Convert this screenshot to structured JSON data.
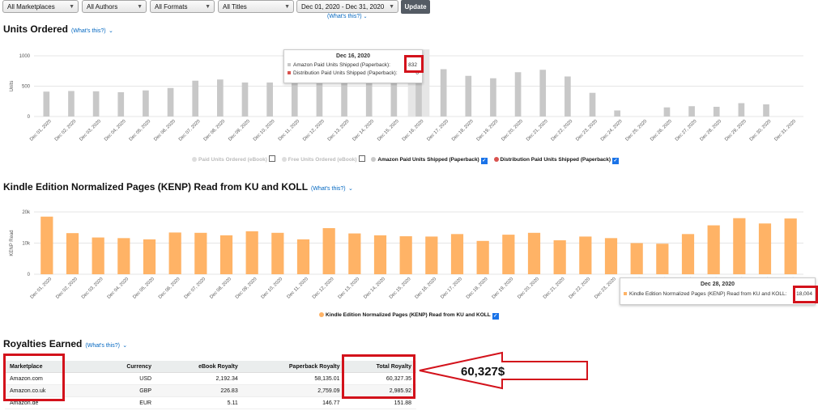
{
  "filters": {
    "marketplaces": "All Marketplaces",
    "authors": "All Authors",
    "formats": "All Formats",
    "titles": "All Titles",
    "date_range": "Dec 01, 2020 - Dec 31, 2020",
    "update_label": "Update",
    "whats_this": "(What's this?)"
  },
  "units": {
    "title": "Units Ordered",
    "whats_this": "(What's this?)",
    "ylabel": "Units",
    "yticks": [
      "1000",
      "500",
      "0"
    ],
    "legend": {
      "paid_ebook": "Paid Units Ordered (eBook)",
      "free_ebook": "Free Units Ordered (eBook)",
      "amazon_paid": "Amazon Paid Units Shipped (Paperback)",
      "distribution_paid": "Distribution Paid Units Shipped (Paperback)"
    },
    "tooltip": {
      "date": "Dec 16, 2020",
      "row1_label": "Amazon Paid Units Shipped (Paperback):",
      "row1_value": "832",
      "row2_label": "Distribution Paid Units Shipped (Paperback):",
      "row2_value": "0"
    }
  },
  "kenp": {
    "title": "Kindle Edition Normalized Pages (KENP) Read from KU and KOLL",
    "whats_this": "(What's this?)",
    "ylabel": "KENP Read",
    "yticks": [
      "20k",
      "10k",
      "0"
    ],
    "legend": "Kindle Edition Normalized Pages (KENP) Read from KU and KOLL",
    "tooltip": {
      "date": "Dec 28, 2020",
      "label": "Kindle Edition Normalized Pages (KENP) Read from KU and KOLL:",
      "value": "18,004"
    }
  },
  "royalties": {
    "title": "Royalties Earned",
    "whats_this": "(What's this?)",
    "columns": [
      "Marketplace",
      "Currency",
      "eBook Royalty",
      "Paperback Royalty",
      "Total Royalty"
    ],
    "rows": [
      [
        "Amazon.com",
        "USD",
        "2,192.34",
        "58,135.01",
        "60,327.35"
      ],
      [
        "Amazon.co.uk",
        "GBP",
        "226.83",
        "2,759.09",
        "2,985.92"
      ],
      [
        "Amazon.de",
        "EUR",
        "5.11",
        "146.77",
        "151.88"
      ]
    ]
  },
  "annotation": {
    "text": "60,327$",
    "color": "#d3121b"
  },
  "colors": {
    "units_bar": "#c8c8c8",
    "units_hover": "#e6e6e6",
    "kenp_bar": "#ffb366",
    "accent_red": "#d3121b",
    "link": "#0066c0"
  },
  "chart_data": [
    {
      "type": "bar",
      "title": "Units Ordered",
      "ylabel": "Units",
      "ylim": [
        0,
        1000
      ],
      "categories": [
        "Dec 01, 2020",
        "Dec 02, 2020",
        "Dec 03, 2020",
        "Dec 04, 2020",
        "Dec 05, 2020",
        "Dec 06, 2020",
        "Dec 07, 2020",
        "Dec 08, 2020",
        "Dec 09, 2020",
        "Dec 10, 2020",
        "Dec 11, 2020",
        "Dec 12, 2020",
        "Dec 13, 2020",
        "Dec 14, 2020",
        "Dec 15, 2020",
        "Dec 16, 2020",
        "Dec 17, 2020",
        "Dec 18, 2020",
        "Dec 19, 2020",
        "Dec 20, 2020",
        "Dec 21, 2020",
        "Dec 22, 2020",
        "Dec 23, 2020",
        "Dec 24, 2020",
        "Dec 25, 2020",
        "Dec 26, 2020",
        "Dec 27, 2020",
        "Dec 28, 2020",
        "Dec 29, 2020",
        "Dec 30, 2020",
        "Dec 31, 2020"
      ],
      "series": [
        {
          "name": "Amazon Paid Units Shipped (Paperback)",
          "values": [
            410,
            420,
            415,
            400,
            430,
            470,
            590,
            610,
            560,
            560,
            590,
            640,
            640,
            620,
            700,
            832,
            780,
            670,
            630,
            730,
            770,
            660,
            390,
            100,
            0,
            150,
            170,
            160,
            220,
            200,
            0
          ]
        },
        {
          "name": "Distribution Paid Units Shipped (Paperback)",
          "values": [
            0,
            0,
            0,
            0,
            0,
            0,
            0,
            0,
            0,
            0,
            0,
            0,
            0,
            0,
            0,
            0,
            0,
            0,
            0,
            0,
            0,
            0,
            0,
            0,
            0,
            0,
            0,
            0,
            0,
            0,
            0
          ]
        }
      ],
      "highlight_index": 15,
      "grid": true
    },
    {
      "type": "bar",
      "title": "Kindle Edition Normalized Pages (KENP) Read from KU and KOLL",
      "ylabel": "KENP Read",
      "ylim": [
        0,
        20000
      ],
      "categories": [
        "Dec 01, 2020",
        "Dec 02, 2020",
        "Dec 03, 2020",
        "Dec 04, 2020",
        "Dec 05, 2020",
        "Dec 06, 2020",
        "Dec 07, 2020",
        "Dec 08, 2020",
        "Dec 09, 2020",
        "Dec 10, 2020",
        "Dec 11, 2020",
        "Dec 12, 2020",
        "Dec 13, 2020",
        "Dec 14, 2020",
        "Dec 15, 2020",
        "Dec 16, 2020",
        "Dec 17, 2020",
        "Dec 18, 2020",
        "Dec 19, 2020",
        "Dec 20, 2020",
        "Dec 21, 2020",
        "Dec 22, 2020",
        "Dec 23, 2020",
        "Dec 24, 2020",
        "Dec 25, 2020",
        "Dec 26, 2020",
        "Dec 27, 2020",
        "Dec 28, 2020",
        "Dec 29, 2020",
        "Dec 30, 2020"
      ],
      "series": [
        {
          "name": "Kindle Edition Normalized Pages (KENP) Read from KU and KOLL",
          "values": [
            18500,
            13200,
            11800,
            11600,
            11200,
            13400,
            13300,
            12500,
            13800,
            13300,
            11200,
            14800,
            13100,
            12500,
            12200,
            12100,
            12900,
            10700,
            12700,
            13300,
            10900,
            12100,
            11600,
            10000,
            9800,
            12900,
            15700,
            18004,
            16300,
            17900
          ]
        }
      ],
      "highlight_index": 27,
      "grid": true
    }
  ]
}
